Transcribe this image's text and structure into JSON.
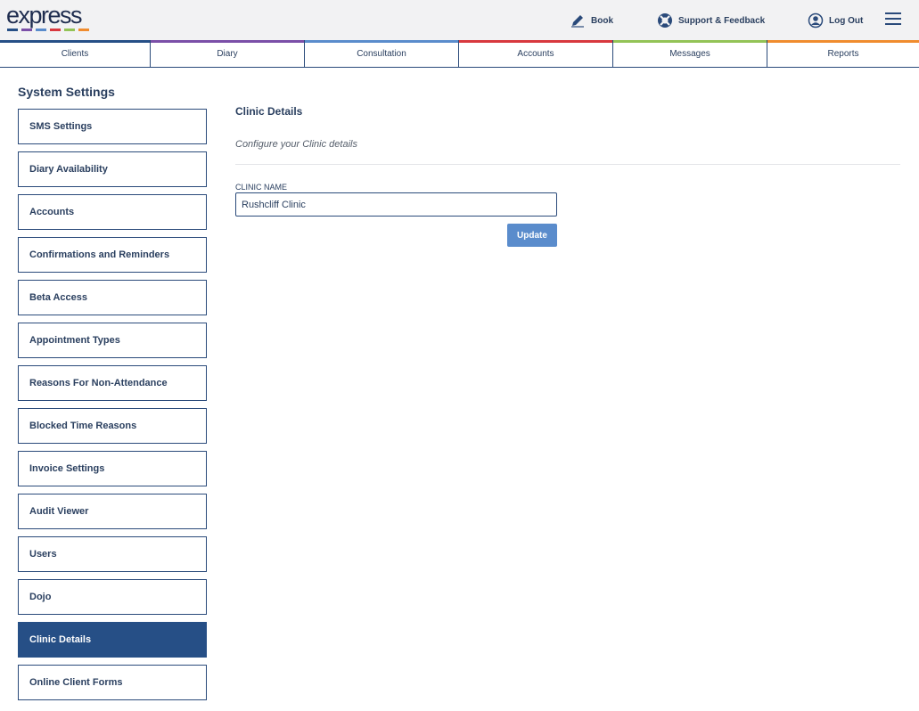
{
  "header": {
    "logo_text": "express",
    "logo_colors": [
      "#264f86",
      "#7b4fa8",
      "#5a8ccc",
      "#d8383e",
      "#93c356",
      "#f08c2e"
    ],
    "actions": [
      {
        "label": "Book",
        "icon": "pencil-icon"
      },
      {
        "label": "Support & Feedback",
        "icon": "lifebuoy-icon"
      },
      {
        "label": "Log Out",
        "icon": "user-circle-icon"
      }
    ],
    "menu_icon": "hamburger-menu-icon"
  },
  "tabs": [
    {
      "label": "Clients",
      "accent": "#264f86"
    },
    {
      "label": "Diary",
      "accent": "#7b4fa8"
    },
    {
      "label": "Consultation",
      "accent": "#5a8ccc"
    },
    {
      "label": "Accounts",
      "accent": "#d8383e"
    },
    {
      "label": "Messages",
      "accent": "#93c356"
    },
    {
      "label": "Reports",
      "accent": "#f08c2e"
    }
  ],
  "sidebar": {
    "title": "System Settings",
    "active_color": "#264f86",
    "items": [
      {
        "label": "SMS Settings",
        "active": false
      },
      {
        "label": "Diary Availability",
        "active": false
      },
      {
        "label": "Accounts",
        "active": false
      },
      {
        "label": "Confirmations and Reminders",
        "active": false
      },
      {
        "label": "Beta Access",
        "active": false
      },
      {
        "label": "Appointment Types",
        "active": false
      },
      {
        "label": "Reasons For Non-Attendance",
        "active": false
      },
      {
        "label": "Blocked Time Reasons",
        "active": false
      },
      {
        "label": "Invoice Settings",
        "active": false
      },
      {
        "label": "Audit Viewer",
        "active": false
      },
      {
        "label": "Users",
        "active": false
      },
      {
        "label": "Dojo",
        "active": false
      },
      {
        "label": "Clinic Details",
        "active": true
      },
      {
        "label": "Online Client Forms",
        "active": false
      }
    ]
  },
  "main": {
    "title": "Clinic Details",
    "subtitle": "Configure your Clinic details",
    "field_label": "CLINIC NAME",
    "field_value": "Rushcliff Clinic",
    "update_label": "Update",
    "button_color": "#5a8ccc"
  }
}
